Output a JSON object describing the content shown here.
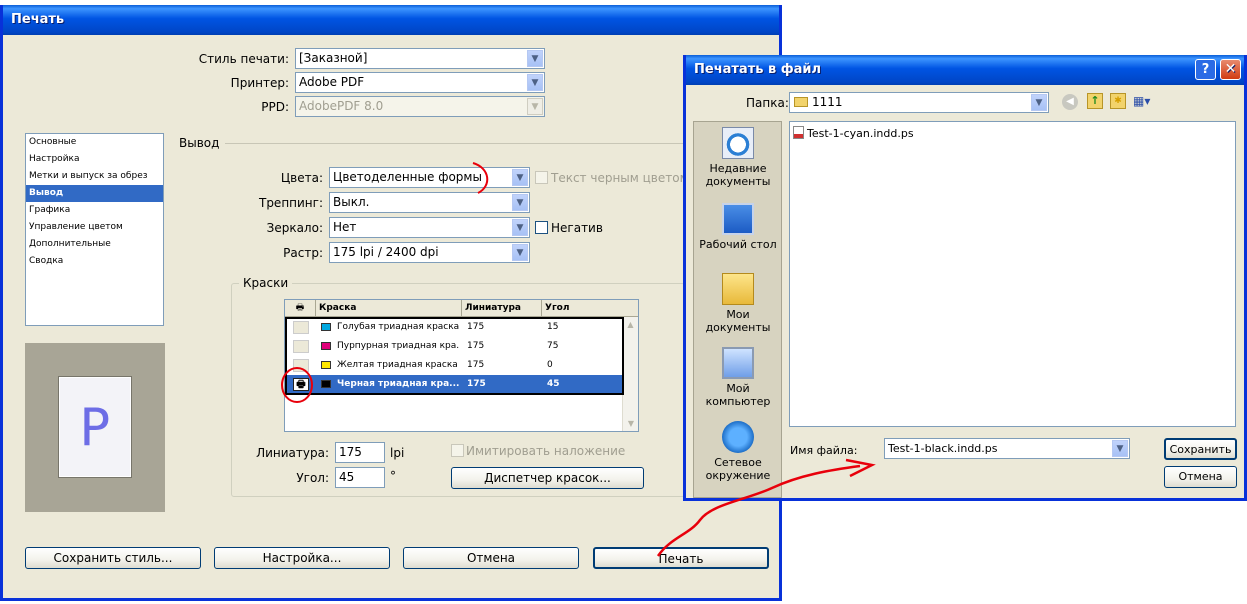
{
  "print_dialog": {
    "title": "Печать",
    "print_style_label": "Стиль печати:",
    "print_style_value": "[Заказной]",
    "printer_label": "Принтер:",
    "printer_value": "Adobe PDF",
    "ppd_label": "PPD:",
    "ppd_value": "AdobePDF 8.0",
    "categories": [
      "Основные",
      "Настройка",
      "Метки и выпуск за обрез",
      "Вывод",
      "Графика",
      "Управление цветом",
      "Дополнительные",
      "Сводка"
    ],
    "selected_category": "Вывод",
    "output_section": "Вывод",
    "colors_label": "Цвета:",
    "colors_value": "Цветоделенные формы",
    "text_black_label": "Текст черным цветом",
    "trapping_label": "Треппинг:",
    "trapping_value": "Выкл.",
    "mirror_label": "Зеркало:",
    "mirror_value": "Нет",
    "negative_label": "Негатив",
    "screening_label": "Растр:",
    "screening_value": "175 lpi / 2400 dpi",
    "inks_group_label": "Краски",
    "ink_headers": {
      "ink": "Краска",
      "frequency": "Линиатура",
      "angle": "Угол"
    },
    "inks": [
      {
        "name": "Голубая триадная краска",
        "frequency": "175",
        "angle": "15",
        "color": "#00a8e0",
        "print": false,
        "selected": false
      },
      {
        "name": "Пурпурная триадная кра...",
        "frequency": "175",
        "angle": "75",
        "color": "#e0007a",
        "print": false,
        "selected": false
      },
      {
        "name": "Желтая триадная краска",
        "frequency": "175",
        "angle": "0",
        "color": "#ffe800",
        "print": false,
        "selected": false
      },
      {
        "name": "Черная триадная кра...",
        "frequency": "175",
        "angle": "45",
        "color": "#000000",
        "print": true,
        "selected": true
      }
    ],
    "frequency_label": "Линиатура:",
    "frequency_value": "175",
    "frequency_unit": "lpi",
    "angle_label": "Угол:",
    "angle_value": "45",
    "angle_unit": "°",
    "simulate_overprint_label": "Имитировать наложение",
    "ink_manager_button": "Диспетчер красок...",
    "preview_letter": "P",
    "buttons": {
      "save_style": "Сохранить стиль...",
      "setup": "Настройка...",
      "cancel": "Отмена",
      "print": "Печать"
    }
  },
  "file_dialog": {
    "title": "Печатать в файл",
    "folder_label": "Папка:",
    "folder_value": "1111",
    "places": [
      {
        "label": "Недавние документы",
        "icon": "recent-documents-icon"
      },
      {
        "label": "Рабочий стол",
        "icon": "desktop-icon"
      },
      {
        "label": "Мои документы",
        "icon": "my-documents-icon"
      },
      {
        "label": "Мой компьютер",
        "icon": "my-computer-icon"
      },
      {
        "label": "Сетевое окружение",
        "icon": "network-icon"
      }
    ],
    "files": [
      "Test-1-cyan.indd.ps"
    ],
    "filename_label": "Имя файла:",
    "filename_value": "Test-1-black.indd.ps",
    "save_button": "Сохранить",
    "cancel_button": "Отмена"
  },
  "colors": {
    "xp_blue": "#0054e3",
    "selection": "#316ac5",
    "annotation_red": "#e8000b",
    "dialog_face": "#ece9d8"
  }
}
